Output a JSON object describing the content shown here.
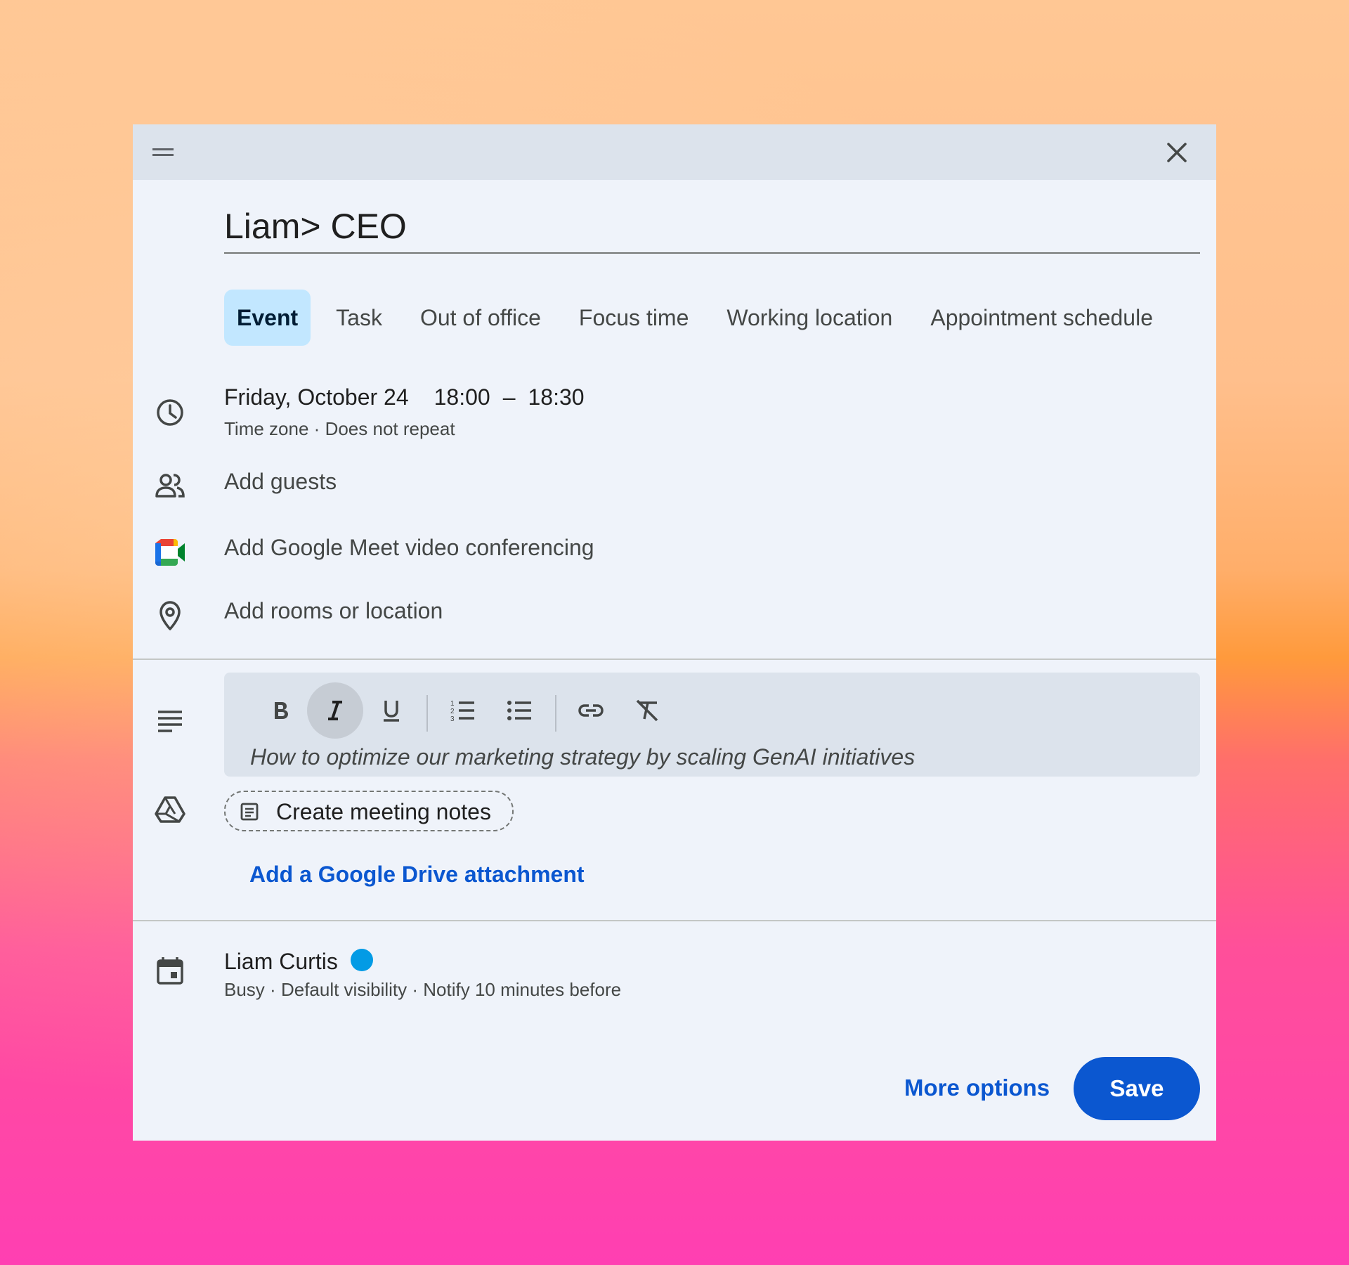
{
  "dialog": {
    "title": "Liam> CEO"
  },
  "tabs": [
    {
      "label": "Event",
      "active": true
    },
    {
      "label": "Task",
      "active": false
    },
    {
      "label": "Out of office",
      "active": false
    },
    {
      "label": "Focus time",
      "active": false
    },
    {
      "label": "Working location",
      "active": false
    },
    {
      "label": "Appointment schedule",
      "active": false
    }
  ],
  "datetime": {
    "date": "Friday, October 24",
    "start": "18:00",
    "separator": "–",
    "end": "18:30",
    "timezone": "Time zone",
    "dot": "·",
    "repeat": "Does not repeat"
  },
  "guests": {
    "label": "Add guests"
  },
  "meet": {
    "label": "Add Google Meet video conferencing"
  },
  "location": {
    "label": "Add rooms or location"
  },
  "description": {
    "text": "How to optimize our marketing strategy by scaling GenAI initiatives",
    "toolbar": [
      "bold",
      "italic",
      "underline",
      "numbered-list",
      "bulleted-list",
      "link",
      "clear-formatting"
    ],
    "active_format": "italic"
  },
  "notes": {
    "label": "Create meeting notes"
  },
  "attachment": {
    "label": "Add a Google Drive attachment"
  },
  "calendar": {
    "owner": "Liam Curtis",
    "color": "#039be5",
    "status": "Busy",
    "visibility": "Default visibility",
    "notify": "Notify 10 minutes before",
    "dot": "·"
  },
  "footer": {
    "more_options": "More options",
    "save": "Save"
  },
  "colors": {
    "accent": "#0b57d0",
    "active_tab": "#c2e7ff"
  },
  "icons": [
    "drag-handle-icon",
    "close-icon",
    "clock-icon",
    "people-icon",
    "google-meet-icon",
    "location-pin-icon",
    "description-icon",
    "google-drive-icon",
    "notes-doc-icon",
    "calendar-icon"
  ]
}
